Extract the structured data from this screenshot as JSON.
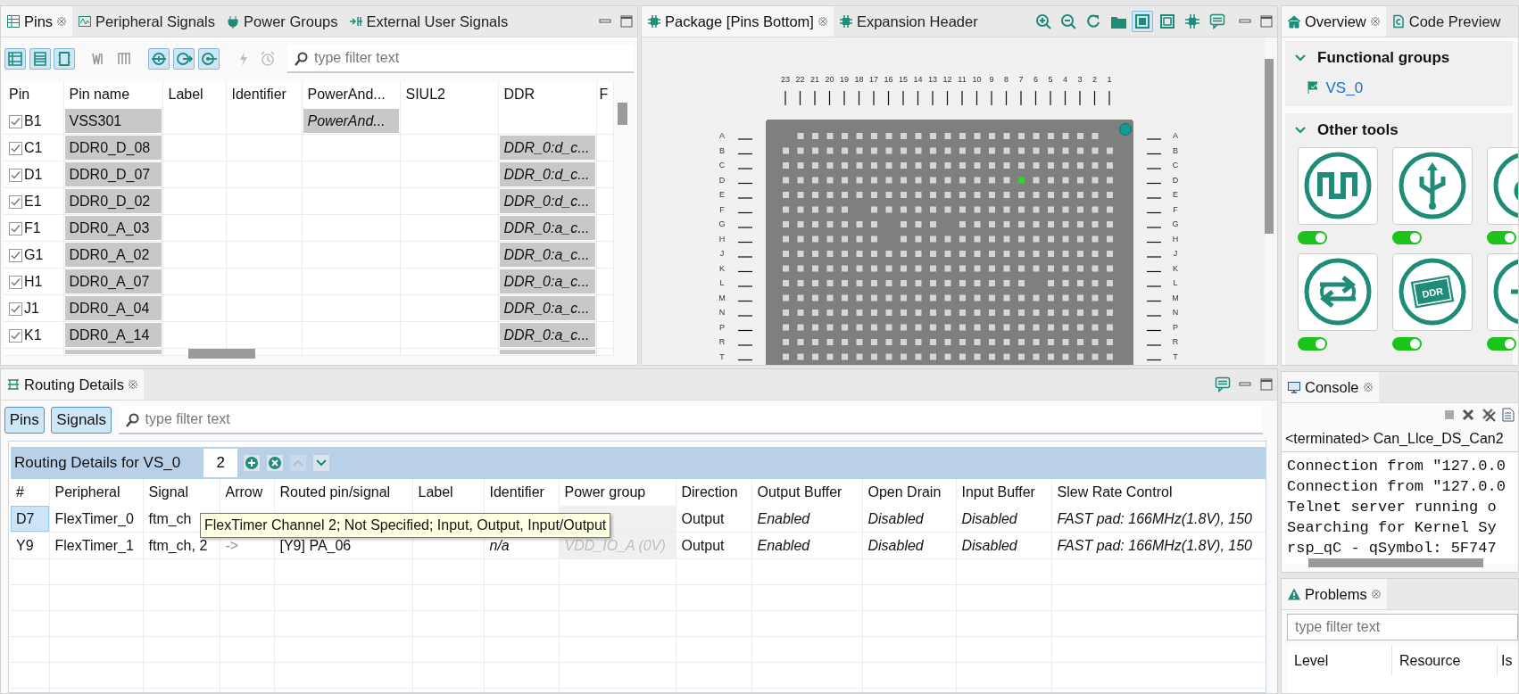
{
  "pins_view": {
    "tabs": [
      {
        "label": "Pins",
        "selected": true
      },
      {
        "label": "Peripheral Signals",
        "selected": false
      },
      {
        "label": "Power Groups",
        "selected": false
      },
      {
        "label": "External User Signals",
        "selected": false
      }
    ],
    "toolbar": [
      {
        "selected": true,
        "disabled": false
      },
      {
        "selected": true,
        "disabled": false
      },
      {
        "selected": true,
        "disabled": false
      },
      {
        "selected": false,
        "disabled": false
      },
      {
        "selected": false,
        "disabled": false
      },
      {
        "selected": true,
        "disabled": false
      },
      {
        "selected": true,
        "disabled": false
      },
      {
        "selected": true,
        "disabled": false
      },
      {
        "selected": false,
        "disabled": true
      },
      {
        "selected": false,
        "disabled": true
      }
    ],
    "filter": {
      "placeholder": "type filter text"
    },
    "columns": [
      "Pin",
      "Pin name",
      "Label",
      "Identifier",
      "PowerAnd...",
      "SIUL2",
      "DDR",
      "F"
    ],
    "rows": [
      {
        "checked": true,
        "pin": "B1",
        "pin_name": "VSS301",
        "power_and": "PowerAnd..."
      },
      {
        "checked": true,
        "pin": "C1",
        "pin_name": "DDR0_D_08",
        "ddr": "DDR_0:d_c..."
      },
      {
        "checked": true,
        "pin": "D1",
        "pin_name": "DDR0_D_07",
        "ddr": "DDR_0:d_c..."
      },
      {
        "checked": true,
        "pin": "E1",
        "pin_name": "DDR0_D_02",
        "ddr": "DDR_0:d_c..."
      },
      {
        "checked": true,
        "pin": "F1",
        "pin_name": "DDR0_A_03",
        "ddr": "DDR_0:a_c..."
      },
      {
        "checked": true,
        "pin": "G1",
        "pin_name": "DDR0_A_02",
        "ddr": "DDR_0:a_c..."
      },
      {
        "checked": true,
        "pin": "H1",
        "pin_name": "DDR0_A_07",
        "ddr": "DDR_0:a_c..."
      },
      {
        "checked": true,
        "pin": "J1",
        "pin_name": "DDR0_A_04",
        "ddr": "DDR_0:a_c..."
      },
      {
        "checked": true,
        "pin": "K1",
        "pin_name": "DDR0_A_14",
        "ddr": "DDR_0:a_c..."
      }
    ]
  },
  "package_view": {
    "tabs": [
      {
        "label": "Package [Pins Bottom]",
        "selected": true
      },
      {
        "label": "Expansion Header",
        "selected": false
      }
    ],
    "toolbar": [
      {
        "selected": false
      },
      {
        "selected": false
      },
      {
        "selected": false
      },
      {
        "selected": false
      },
      {
        "selected": true
      },
      {
        "selected": false
      },
      {
        "selected": false
      },
      {
        "selected": false
      }
    ],
    "package": {
      "columns": [
        "23",
        "22",
        "21",
        "20",
        "19",
        "18",
        "17",
        "16",
        "15",
        "14",
        "13",
        "12",
        "11",
        "10",
        "9",
        "8",
        "7",
        "6",
        "5",
        "4",
        "3",
        "2",
        "1"
      ],
      "rows": [
        {
          "left": "A",
          "right": "A"
        },
        {
          "left": "B",
          "right": "B"
        },
        {
          "left": "C",
          "right": "C"
        },
        {
          "left": "D",
          "right": "D"
        },
        {
          "left": "E",
          "right": "E"
        },
        {
          "left": "F",
          "right": "F"
        },
        {
          "left": "G",
          "right": "G"
        },
        {
          "left": "H",
          "right": "H"
        },
        {
          "left": "J",
          "right": "J"
        },
        {
          "left": "K",
          "right": "K"
        },
        {
          "left": "L",
          "right": "L"
        },
        {
          "left": "M",
          "right": "M"
        },
        {
          "left": "N",
          "right": "N"
        },
        {
          "left": "P",
          "right": "P"
        },
        {
          "left": "R",
          "right": "R"
        },
        {
          "left": "T",
          "right": "T"
        }
      ]
    }
  },
  "overview": {
    "tabs": [
      {
        "label": "Overview",
        "selected": true
      },
      {
        "label": "Code Preview",
        "selected": false
      }
    ],
    "functional_groups": {
      "title": "Functional groups",
      "expanded": true,
      "items": [
        {
          "label": "VS_0"
        }
      ]
    },
    "other_tools": {
      "title": "Other tools",
      "expanded": true,
      "tools": [
        {
          "kind": "wave",
          "on": true
        },
        {
          "kind": "usb",
          "on": true
        },
        {
          "kind": "ring",
          "on": true
        },
        {
          "kind": "arrows",
          "on": true
        },
        {
          "kind": "chip",
          "icon_text": "DDR",
          "on": true
        },
        {
          "kind": "plus",
          "on": true
        }
      ]
    }
  },
  "routing": {
    "tabs": [
      {
        "label": "Routing Details",
        "selected": true
      }
    ],
    "mode_buttons": [
      {
        "label": "Pins",
        "selected": true
      },
      {
        "label": "Signals",
        "selected": true
      }
    ],
    "filter": {
      "placeholder": "type filter text"
    },
    "header": {
      "title": "Routing Details for VS_0",
      "count": "2",
      "actions": [
        {
          "disabled": false
        },
        {
          "disabled": false
        },
        {
          "disabled": true
        },
        {
          "disabled": false
        }
      ]
    },
    "columns": [
      "#",
      "Peripheral",
      "Signal",
      "Arrow",
      "Routed pin/signal",
      "Label",
      "Identifier",
      "Power group",
      "Direction",
      "Output Buffer",
      "Open Drain",
      "Input Buffer",
      "Slew Rate Control"
    ],
    "rows": [
      {
        "selected": true,
        "num": "D7",
        "peripheral": "FlexTimer_0",
        "signal": "ftm_ch",
        "direction": "Output",
        "output_buffer": "Enabled",
        "open_drain": "Disabled",
        "input_buffer": "Disabled",
        "slew": "FAST pad: 166MHz(1.8V), 150"
      },
      {
        "selected": false,
        "num": "Y9",
        "peripheral": "FlexTimer_1",
        "signal": "ftm_ch, 2",
        "arrow": "->",
        "routed": "[Y9] PA_06",
        "identifier": "n/a",
        "power_group": "VDD_IO_A (0V)",
        "direction": "Output",
        "output_buffer": "Enabled",
        "open_drain": "Disabled",
        "input_buffer": "Disabled",
        "slew": "FAST pad: 166MHz(1.8V), 150"
      }
    ],
    "tooltip": "FlexTimer Channel 2; Not Specified; Input, Output, Input/Output"
  },
  "console": {
    "tabs": [
      {
        "label": "Console",
        "selected": true
      }
    ],
    "process": "<terminated> Can_Llce_DS_Can2",
    "lines": [
      "Connection from \"127.0.0",
      "Connection from \"127.0.0",
      "Telnet server running o",
      "Searching for Kernel Sy",
      "rsp_qC - qSymbol: 5F747"
    ]
  },
  "problems": {
    "tabs": [
      {
        "label": "Problems",
        "selected": true
      }
    ],
    "filter": {
      "placeholder": "type filter text"
    },
    "columns": [
      "Level",
      "Resource",
      "Is"
    ]
  }
}
